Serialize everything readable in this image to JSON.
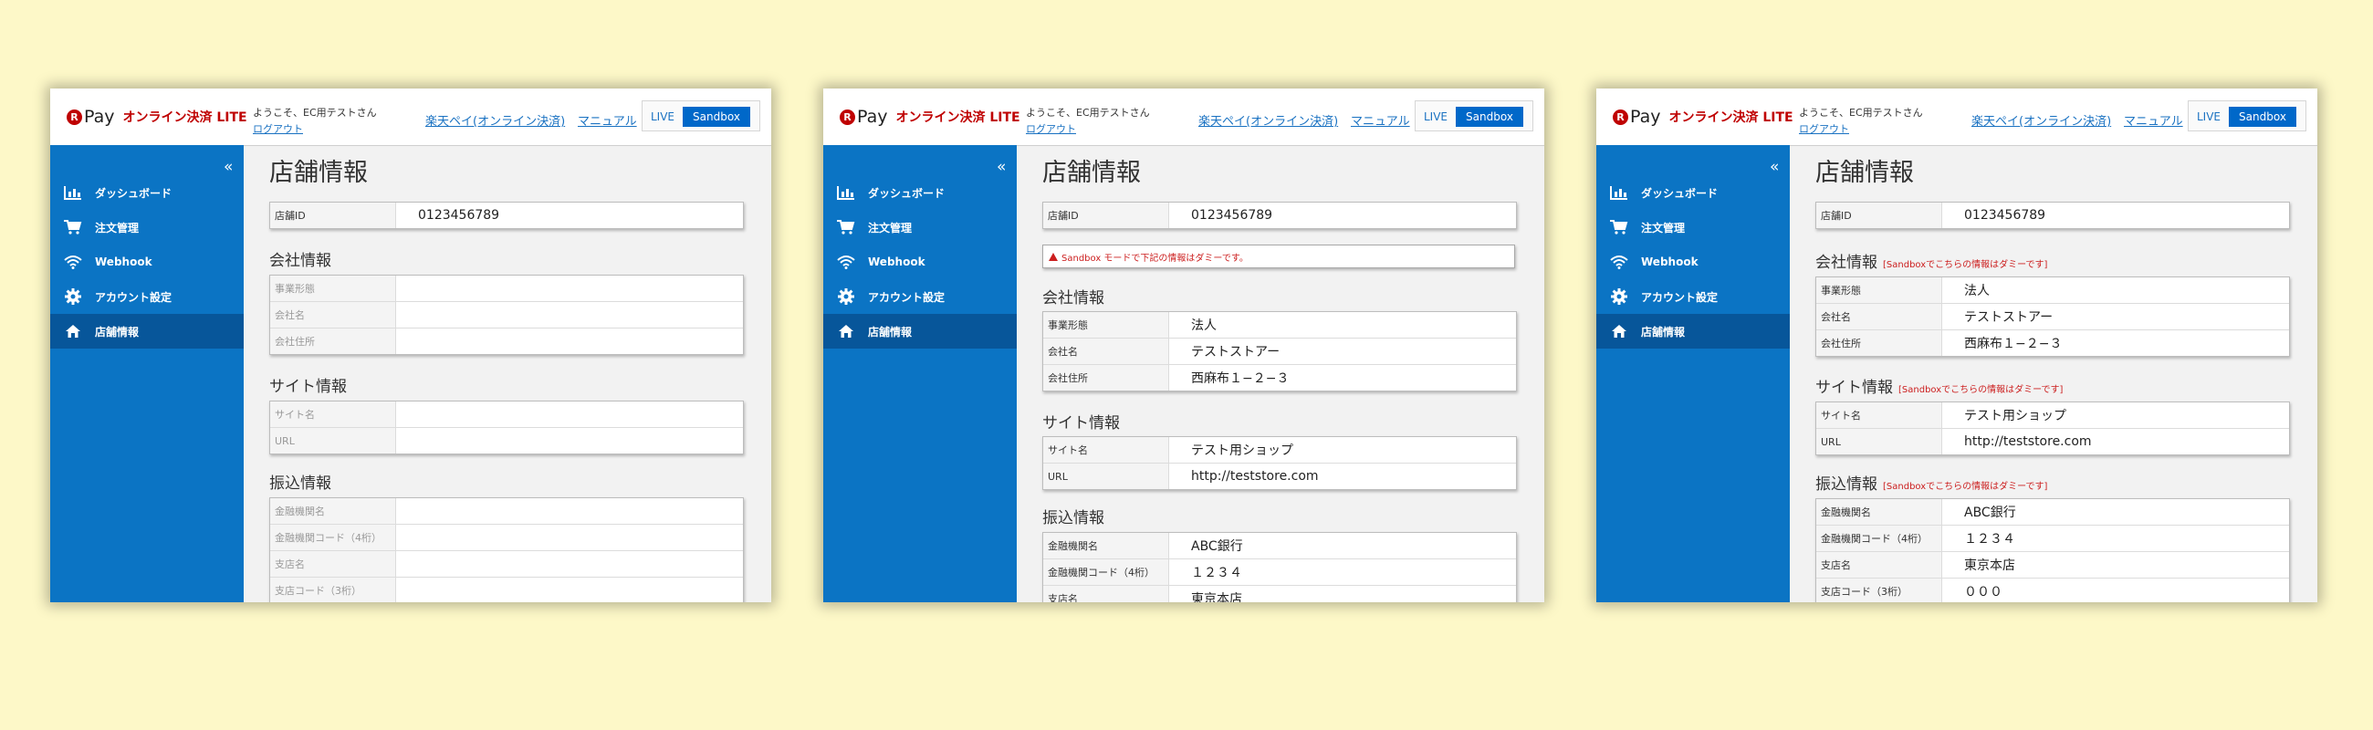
{
  "header": {
    "logo_pay": "Pay",
    "logo_sub": "オンライン決済 LITE",
    "welcome": "ようこそ、EC用テストさん",
    "logout": "ログアウト",
    "link_payment": "楽天ペイ(オンライン決済)",
    "link_manual": "マニュアル",
    "env_live": "LIVE",
    "env_sandbox": "Sandbox"
  },
  "sidebar": {
    "collapse": "«",
    "items": [
      {
        "label": "ダッシュボード",
        "icon": "bar-chart-icon"
      },
      {
        "label": "注文管理",
        "icon": "cart-icon"
      },
      {
        "label": "Webhook",
        "icon": "wifi-icon"
      },
      {
        "label": "アカウント設定",
        "icon": "gear-icon"
      },
      {
        "label": "店舗情報",
        "icon": "home-icon",
        "active": true
      }
    ]
  },
  "page": {
    "title": "店舗情報",
    "shop_id_label": "店舗ID",
    "shop_id": "0123456789",
    "company_title": "会社情報",
    "site_title": "サイト情報",
    "bank_title": "振込情報",
    "company_labels": [
      "事業形態",
      "会社名",
      "会社住所"
    ],
    "site_labels": [
      "サイト名",
      "URL"
    ],
    "bank_labels": [
      "金融機関名",
      "金融機関コード（4桁）",
      "支店名",
      "支店コード（3桁）"
    ]
  },
  "values": {
    "company": [
      "法人",
      "テストストアー",
      "西麻布１−２−３"
    ],
    "site": [
      "テスト用ショップ",
      "http://teststore.com"
    ],
    "bank": [
      "ABC銀行",
      "１２３４",
      "東京本店",
      "０００"
    ]
  },
  "panel2": {
    "alert": "Sandbox モードで下記の情報はダミーです。"
  },
  "panel3": {
    "note": "[Sandboxでこちらの情報はダミーです]"
  },
  "colors": {
    "sidebar": "#0b74c4",
    "sidebar_active": "#07569a",
    "brand_red": "#bf0000",
    "link": "#1a72c2",
    "note_red": "#cc1f1f",
    "background": "#fdf8c8"
  }
}
